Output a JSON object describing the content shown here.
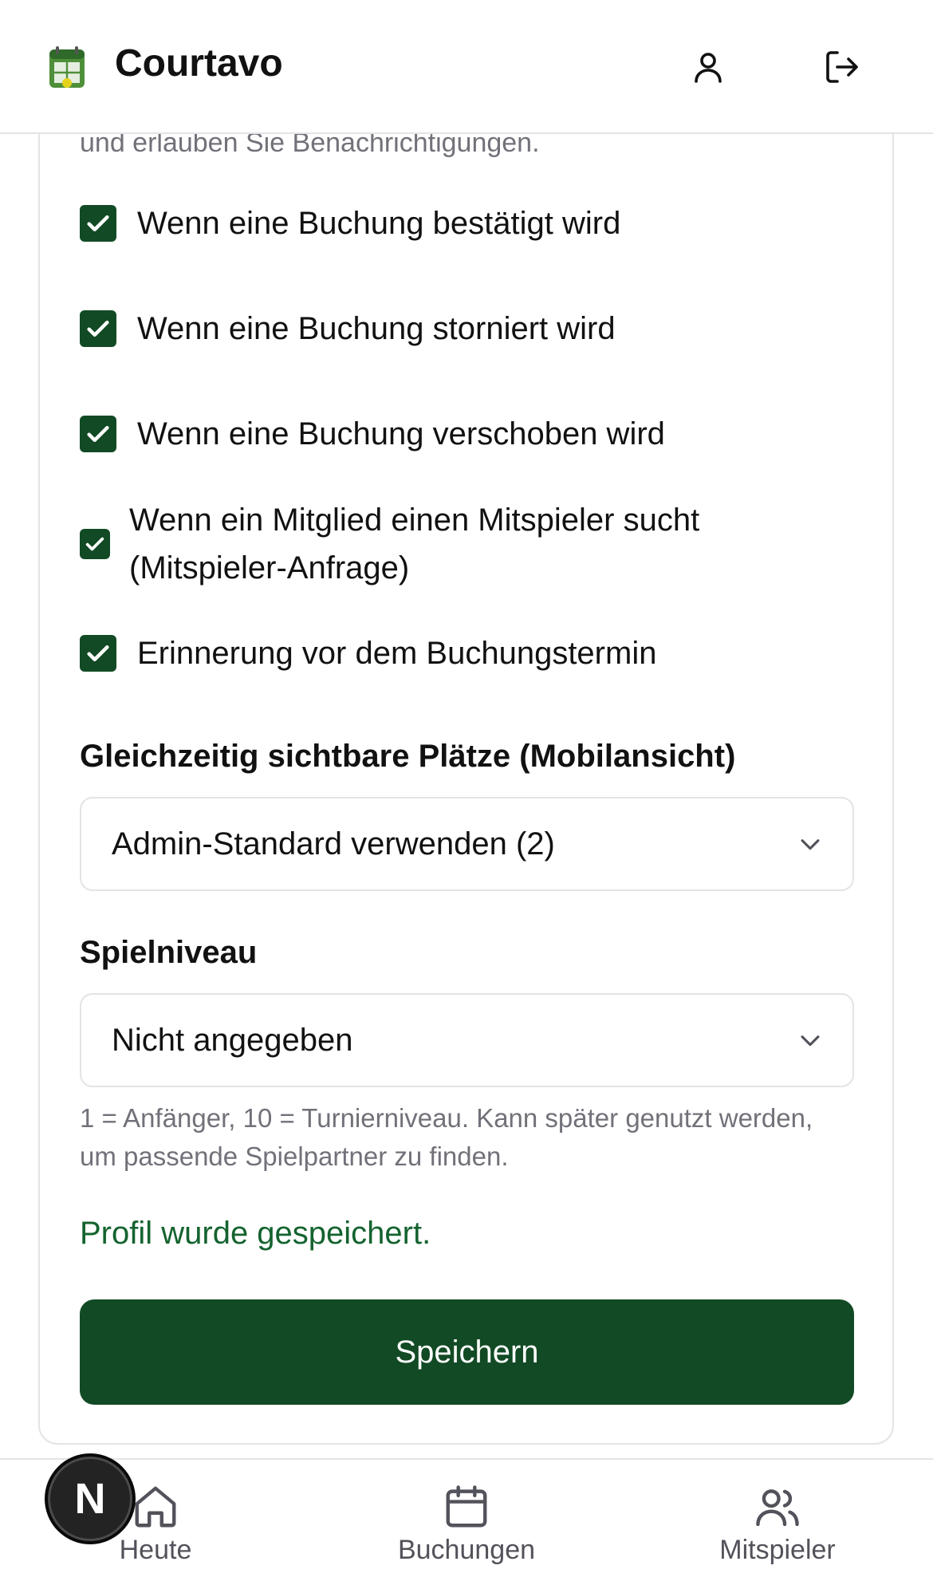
{
  "header": {
    "brand": "Courtavo",
    "profile_icon": "user-icon",
    "logout_icon": "log-out-icon",
    "logo_icon": "court-calendar-logo"
  },
  "notifications": {
    "cut_text": "und erlauben Sie Benachrichtigungen.",
    "options": [
      {
        "label": "Wenn eine Buchung bestätigt wird",
        "checked": true
      },
      {
        "label": "Wenn eine Buchung storniert wird",
        "checked": true
      },
      {
        "label": "Wenn eine Buchung verschoben wird",
        "checked": true
      },
      {
        "label": "Wenn ein Mitglied einen Mitspieler sucht (Mitspieler-Anfrage)",
        "checked": true
      },
      {
        "label": "Erinnerung vor dem Buchungstermin",
        "checked": true
      }
    ]
  },
  "courts_visible": {
    "label": "Gleichzeitig sichtbare Plätze (Mobilansicht)",
    "value": "Admin-Standard verwenden (2)"
  },
  "skill_level": {
    "label": "Spielniveau",
    "value": "Nicht angegeben",
    "helper": "1 = Anfänger, 10 = Turnierniveau. Kann später genutzt werden, um passende Spielpartner zu finden."
  },
  "status": {
    "success": "Profil wurde gespeichert."
  },
  "actions": {
    "save_label": "Speichern"
  },
  "bottom_nav": {
    "items": [
      {
        "label": "Heute",
        "icon": "home-icon"
      },
      {
        "label": "Buchungen",
        "icon": "calendar-icon"
      },
      {
        "label": "Mitspieler",
        "icon": "users-icon"
      }
    ]
  },
  "dev_badge": {
    "letter": "N"
  },
  "colors": {
    "primary": "#114a24",
    "success_text": "#14632f",
    "muted_text": "#71717a",
    "border": "#e4e4e7"
  }
}
